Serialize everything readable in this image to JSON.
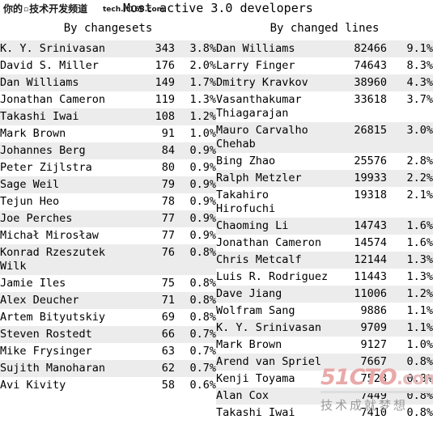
{
  "title": {
    "text": "Most active 3.0 developers"
  },
  "watermarks": {
    "channel_cn": "你的",
    "channel_sep": "▫",
    "channel_cn2": "技术开发频道",
    "site_url": "tech.it168.com",
    "brand": "51CTO",
    "brand_tld": ".com",
    "slogan": "技术成就梦想"
  },
  "columns": [
    {
      "id": "by-changesets",
      "header": "By changesets",
      "rows": [
        {
          "name": "K. Y. Srinivasan",
          "count": "343",
          "percent": "3.8%"
        },
        {
          "name": "David S. Miller",
          "count": "176",
          "percent": "2.0%"
        },
        {
          "name": "Dan Williams",
          "count": "149",
          "percent": "1.7%"
        },
        {
          "name": "Jonathan Cameron",
          "count": "119",
          "percent": "1.3%"
        },
        {
          "name": "Takashi Iwai",
          "count": "108",
          "percent": "1.2%"
        },
        {
          "name": "Mark Brown",
          "count": "91",
          "percent": "1.0%"
        },
        {
          "name": "Johannes Berg",
          "count": "84",
          "percent": "0.9%"
        },
        {
          "name": "Peter Zijlstra",
          "count": "80",
          "percent": "0.9%"
        },
        {
          "name": "Sage Weil",
          "count": "79",
          "percent": "0.9%"
        },
        {
          "name": "Tejun Heo",
          "count": "78",
          "percent": "0.9%"
        },
        {
          "name": "Joe Perches",
          "count": "77",
          "percent": "0.9%"
        },
        {
          "name": "Michał Mirosław",
          "count": "77",
          "percent": "0.9%"
        },
        {
          "name": "Konrad Rzeszutek Wilk",
          "count": "76",
          "percent": "0.8%"
        },
        {
          "name": "Jamie Iles",
          "count": "75",
          "percent": "0.8%"
        },
        {
          "name": "Alex Deucher",
          "count": "71",
          "percent": "0.8%"
        },
        {
          "name": "Artem Bityutskiy",
          "count": "69",
          "percent": "0.8%"
        },
        {
          "name": "Steven Rostedt",
          "count": "66",
          "percent": "0.7%"
        },
        {
          "name": "Mike Frysinger",
          "count": "63",
          "percent": "0.7%"
        },
        {
          "name": "Sujith Manoharan",
          "count": "62",
          "percent": "0.7%"
        },
        {
          "name": "Avi Kivity",
          "count": "58",
          "percent": "0.6%"
        }
      ]
    },
    {
      "id": "by-changed-lines",
      "header": "By changed lines",
      "rows": [
        {
          "name": "Dan Williams",
          "count": "82466",
          "percent": "9.1%"
        },
        {
          "name": "Larry Finger",
          "count": "74643",
          "percent": "8.3%"
        },
        {
          "name": "Dmitry Kravkov",
          "count": "38960",
          "percent": "4.3%"
        },
        {
          "name": "Vasanthakumar Thiagarajan",
          "count": "33618",
          "percent": "3.7%"
        },
        {
          "name": "Mauro Carvalho Chehab",
          "count": "26815",
          "percent": "3.0%"
        },
        {
          "name": "Bing Zhao",
          "count": "25576",
          "percent": "2.8%"
        },
        {
          "name": "Ralph Metzler",
          "count": "19933",
          "percent": "2.2%"
        },
        {
          "name": "Takahiro Hirofuchi",
          "count": "19318",
          "percent": "2.1%"
        },
        {
          "name": "Chaoming Li",
          "count": "14743",
          "percent": "1.6%"
        },
        {
          "name": "Jonathan Cameron",
          "count": "14574",
          "percent": "1.6%"
        },
        {
          "name": "Chris Metcalf",
          "count": "12144",
          "percent": "1.3%"
        },
        {
          "name": "Luis R. Rodriguez",
          "count": "11443",
          "percent": "1.3%"
        },
        {
          "name": "Dave Jiang",
          "count": "11006",
          "percent": "1.2%"
        },
        {
          "name": "Wolfram Sang",
          "count": "9886",
          "percent": "1.1%"
        },
        {
          "name": "K. Y. Srinivasan",
          "count": "9709",
          "percent": "1.1%"
        },
        {
          "name": "Mark Brown",
          "count": "9127",
          "percent": "1.0%"
        },
        {
          "name": "Arend van Spriel",
          "count": "7667",
          "percent": "0.8%"
        },
        {
          "name": "Kenji Toyama",
          "count": "7528",
          "percent": "0.8%"
        },
        {
          "name": "Alan Cox",
          "count": "7449",
          "percent": "0.8%"
        },
        {
          "name": "Takashi Iwai",
          "count": "7410",
          "percent": "0.8%"
        }
      ]
    }
  ]
}
